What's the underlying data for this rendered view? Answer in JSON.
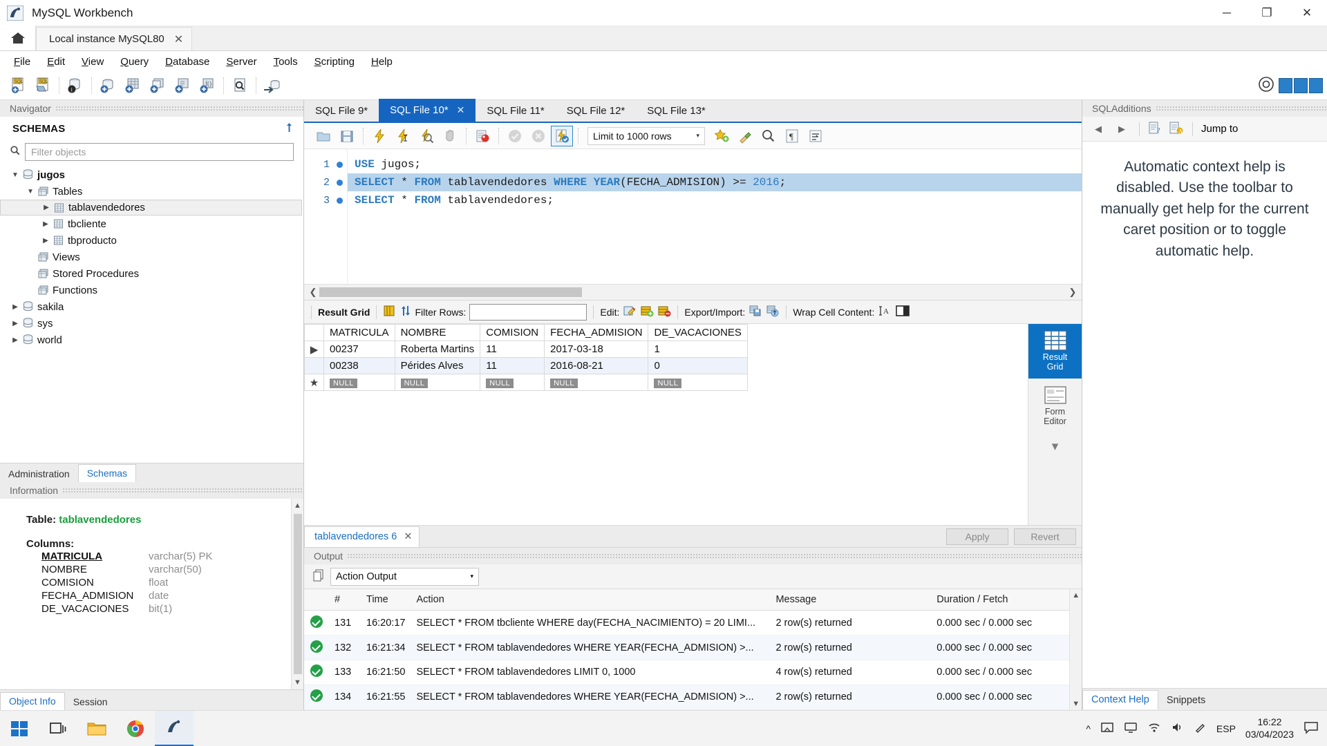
{
  "window": {
    "title": "MySQL Workbench",
    "minimize_label": "─",
    "maximize_label": "❐",
    "close_label": "✕"
  },
  "instance_tab": {
    "label": "Local instance MySQL80",
    "close": "✕",
    "home": "home-icon"
  },
  "menu": [
    {
      "accel": "F",
      "rest": "ile"
    },
    {
      "accel": "E",
      "rest": "dit"
    },
    {
      "accel": "V",
      "rest": "iew"
    },
    {
      "accel": "Q",
      "rest": "uery"
    },
    {
      "accel": "D",
      "rest": "atabase"
    },
    {
      "accel": "S",
      "rest": "erver"
    },
    {
      "accel": "T",
      "rest": "ools"
    },
    {
      "accel": "S",
      "rest": "cripting"
    },
    {
      "accel": "H",
      "rest": "elp"
    }
  ],
  "navigator": {
    "header": "Navigator",
    "section": "SCHEMAS",
    "refresh_icon": "refresh-icon",
    "filter_placeholder": "Filter objects",
    "filter_value": "",
    "tree": [
      {
        "label": "jugos",
        "indent": 0,
        "expanded": true,
        "bold": true,
        "icon": "schema-icon",
        "selected": false
      },
      {
        "label": "Tables",
        "indent": 1,
        "expanded": true,
        "bold": false,
        "icon": "folder-icon",
        "selected": false
      },
      {
        "label": "tablavendedores",
        "indent": 2,
        "expanded": false,
        "bold": false,
        "icon": "table-icon",
        "selected": true
      },
      {
        "label": "tbcliente",
        "indent": 2,
        "expanded": false,
        "bold": false,
        "icon": "table-icon",
        "selected": false
      },
      {
        "label": "tbproducto",
        "indent": 2,
        "expanded": false,
        "bold": false,
        "icon": "table-icon",
        "selected": false
      },
      {
        "label": "Views",
        "indent": 1,
        "expanded": null,
        "bold": false,
        "icon": "folder-icon",
        "selected": false
      },
      {
        "label": "Stored Procedures",
        "indent": 1,
        "expanded": null,
        "bold": false,
        "icon": "folder-icon",
        "selected": false
      },
      {
        "label": "Functions",
        "indent": 1,
        "expanded": null,
        "bold": false,
        "icon": "folder-icon",
        "selected": false
      },
      {
        "label": "sakila",
        "indent": 0,
        "expanded": false,
        "bold": false,
        "icon": "schema-icon",
        "selected": false
      },
      {
        "label": "sys",
        "indent": 0,
        "expanded": false,
        "bold": false,
        "icon": "schema-icon",
        "selected": false
      },
      {
        "label": "world",
        "indent": 0,
        "expanded": false,
        "bold": false,
        "icon": "schema-icon",
        "selected": false
      }
    ],
    "bottom_tabs": [
      {
        "label": "Administration",
        "active": false
      },
      {
        "label": "Schemas",
        "active": true
      }
    ]
  },
  "information": {
    "header": "Information",
    "table_label": "Table:",
    "table_name": "tablavendedores",
    "columns_label": "Columns:",
    "columns": [
      {
        "name": "MATRICULA",
        "type": "varchar(5) PK",
        "pk": true
      },
      {
        "name": "NOMBRE",
        "type": "varchar(50)",
        "pk": false
      },
      {
        "name": "COMISION",
        "type": "float",
        "pk": false
      },
      {
        "name": "FECHA_ADMISION",
        "type": "date",
        "pk": false
      },
      {
        "name": "DE_VACACIONES",
        "type": "bit(1)",
        "pk": false
      }
    ],
    "bottom_tabs": [
      {
        "label": "Object Info",
        "active": true
      },
      {
        "label": "Session",
        "active": false
      }
    ]
  },
  "sql_tabs": [
    {
      "label": "SQL File 9*",
      "active": false,
      "closable": false
    },
    {
      "label": "SQL File 10*",
      "active": true,
      "closable": true
    },
    {
      "label": "SQL File 11*",
      "active": false,
      "closable": false
    },
    {
      "label": "SQL File 12*",
      "active": false,
      "closable": false
    },
    {
      "label": "SQL File 13*",
      "active": false,
      "closable": false
    }
  ],
  "sql_toolbar": {
    "limit_label": "Limit to 1000 rows",
    "caret": "▾",
    "buttons": [
      "open-script-icon",
      "save-script-icon",
      "execute-icon",
      "execute-current-icon",
      "explain-icon",
      "stop-icon",
      "toggle-breakpoint-icon",
      "commit-icon",
      "rollback-icon",
      "autocommit-icon",
      "beautify-icon",
      "find-icon",
      "toggle-invisible-icon",
      "wrap-lines-icon"
    ]
  },
  "editor": {
    "lines": [
      {
        "number": "1",
        "highlighted": false,
        "tokens": [
          {
            "t": "USE",
            "c": "kw"
          },
          {
            "t": " ",
            "c": "op"
          },
          {
            "t": "jugos;",
            "c": "id"
          }
        ],
        "plain": "USE jugos;"
      },
      {
        "number": "2",
        "highlighted": true,
        "tokens": [
          {
            "t": "SELECT",
            "c": "kw"
          },
          {
            "t": " ",
            "c": "op"
          },
          {
            "t": "*",
            "c": "op"
          },
          {
            "t": " ",
            "c": "op"
          },
          {
            "t": "FROM",
            "c": "kw"
          },
          {
            "t": " ",
            "c": "op"
          },
          {
            "t": "tablavendedores",
            "c": "id"
          },
          {
            "t": " ",
            "c": "op"
          },
          {
            "t": "WHERE",
            "c": "kw"
          },
          {
            "t": " ",
            "c": "op"
          },
          {
            "t": "YEAR",
            "c": "kw"
          },
          {
            "t": "(",
            "c": "op"
          },
          {
            "t": "FECHA_ADMISION",
            "c": "id"
          },
          {
            "t": ")",
            "c": "op"
          },
          {
            "t": " ",
            "c": "op"
          },
          {
            "t": ">=",
            "c": "op"
          },
          {
            "t": " ",
            "c": "op"
          },
          {
            "t": "2016",
            "c": "num"
          },
          {
            "t": ";",
            "c": "op"
          }
        ],
        "plain": "SELECT * FROM tablavendedores WHERE YEAR(FECHA_ADMISION) >= 2016;"
      },
      {
        "number": "3",
        "highlighted": false,
        "tokens": [
          {
            "t": "SELECT",
            "c": "kw"
          },
          {
            "t": " ",
            "c": "op"
          },
          {
            "t": "*",
            "c": "op"
          },
          {
            "t": " ",
            "c": "op"
          },
          {
            "t": "FROM",
            "c": "kw"
          },
          {
            "t": " ",
            "c": "op"
          },
          {
            "t": "tablavendedores;",
            "c": "id"
          }
        ],
        "plain": "SELECT * FROM tablavendedores;"
      }
    ]
  },
  "grid_toolbar": {
    "result_grid_label": "Result Grid",
    "filter_label": "Filter Rows:",
    "filter_value": "",
    "edit_label": "Edit:",
    "export_label": "Export/Import:",
    "wrap_label": "Wrap Cell Content:",
    "wrap_icon": "wrap-text-icon"
  },
  "result_grid": {
    "columns": [
      "MATRICULA",
      "NOMBRE",
      "COMISION",
      "FECHA_ADMISION",
      "DE_VACACIONES"
    ],
    "rows": [
      {
        "marker": "▶",
        "cells": [
          "00237",
          "Roberta Martins",
          "11",
          "2017-03-18",
          "1"
        ]
      },
      {
        "marker": "",
        "cells": [
          "00238",
          "Pérides Alves",
          "11",
          "2016-08-21",
          "0"
        ]
      }
    ],
    "null_row": {
      "marker": "*",
      "cells": [
        "NULL",
        "NULL",
        "NULL",
        "NULL",
        "NULL"
      ]
    }
  },
  "right_strip": [
    {
      "line1": "Result",
      "line2": "Grid",
      "icon": "grid-icon",
      "active": true
    },
    {
      "line1": "Form",
      "line2": "Editor",
      "icon": "form-icon",
      "active": false
    }
  ],
  "result_footer": {
    "tab_label": "tablavendedores 6",
    "tab_close": "✕",
    "apply_label": "Apply",
    "revert_label": "Revert",
    "context_tabs": [
      {
        "label": "Context Help",
        "active": true
      },
      {
        "label": "Snippets",
        "active": false
      }
    ]
  },
  "output": {
    "header": "Output",
    "selector_value": "Action Output",
    "selector_caret": "▾",
    "columns": [
      "#",
      "Time",
      "Action",
      "Message",
      "Duration / Fetch"
    ],
    "rows": [
      {
        "status": "ok",
        "num": "131",
        "time": "16:20:17",
        "action": "SELECT * FROM tbcliente WHERE day(FECHA_NACIMIENTO) = 20 LIMI...",
        "message": "2 row(s) returned",
        "duration": "0.000 sec / 0.000 sec"
      },
      {
        "status": "ok",
        "num": "132",
        "time": "16:21:34",
        "action": "SELECT * FROM tablavendedores WHERE YEAR(FECHA_ADMISION) >...",
        "message": "2 row(s) returned",
        "duration": "0.000 sec / 0.000 sec"
      },
      {
        "status": "ok",
        "num": "133",
        "time": "16:21:50",
        "action": "SELECT * FROM tablavendedores LIMIT 0, 1000",
        "message": "4 row(s) returned",
        "duration": "0.000 sec / 0.000 sec"
      },
      {
        "status": "ok",
        "num": "134",
        "time": "16:21:55",
        "action": "SELECT * FROM tablavendedores WHERE YEAR(FECHA_ADMISION) >...",
        "message": "2 row(s) returned",
        "duration": "0.000 sec / 0.000 sec"
      }
    ]
  },
  "sql_additions": {
    "header": "SQLAdditions",
    "jump_to_label": "Jump to",
    "help_text": "Automatic context help is disabled. Use the toolbar to manually get help for the current caret position or to toggle automatic help."
  },
  "taskbar": {
    "items": [
      "start-icon",
      "task-view-icon",
      "file-explorer-icon",
      "chrome-icon",
      "mysql-workbench-icon"
    ],
    "tray": [
      "chevron-up-icon",
      "onedrive-icon",
      "display-icon",
      "wifi-icon",
      "volume-icon",
      "pen-icon"
    ],
    "language": "ESP",
    "time": "16:22",
    "date": "03/04/2023",
    "notifications_icon": "notifications-icon"
  },
  "colors": {
    "accent": "#1565c0",
    "tab_active": "#1565c0",
    "strip_active": "#0c71c3",
    "keyword": "#2a7ac0",
    "selection": "#b8d4ec",
    "table_name": "#1a9e3c",
    "success": "#24a148"
  }
}
